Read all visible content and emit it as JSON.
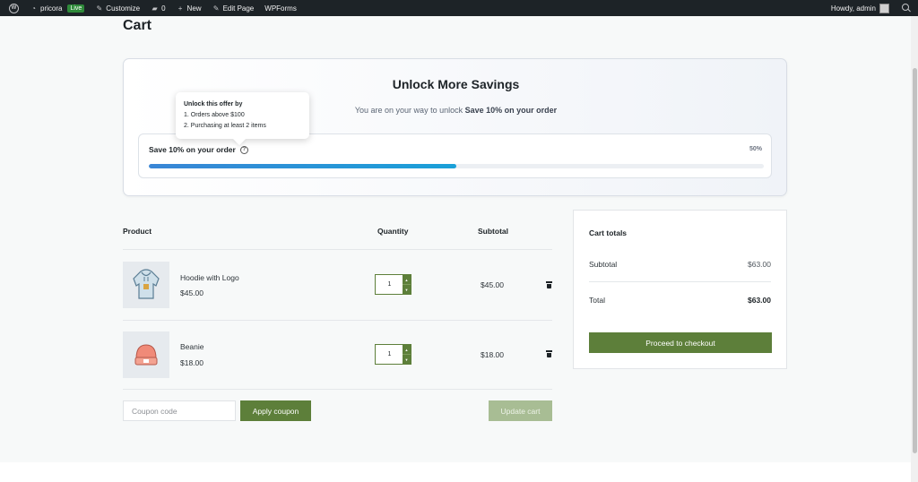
{
  "adminbar": {
    "site_name": "pricora",
    "live_badge": "Live",
    "customize": "Customize",
    "comments_count": "0",
    "new": "New",
    "edit_page": "Edit Page",
    "wpforms": "WPForms",
    "howdy": "Howdy, admin"
  },
  "page": {
    "title": "Cart"
  },
  "savings": {
    "title": "Unlock More Savings",
    "subtitle_prefix": "You are on your way to unlock",
    "subtitle_offer": "Save 10% on your order",
    "offer_label": "Save 10% on your order",
    "progress_label": "50%",
    "progress_fraction": 0.5,
    "progress_color": "#1aa0d8"
  },
  "tooltip": {
    "title": "Unlock this offer by",
    "line1": "1. Orders above $100",
    "line2": "2. Purchasing at least 2 items"
  },
  "table": {
    "headers": {
      "product": "Product",
      "quantity": "Quantity",
      "subtotal": "Subtotal"
    },
    "rows": [
      {
        "name": "Hoodie with Logo",
        "price": "$45.00",
        "qty": "1",
        "subtotal": "$45.00",
        "image": "hoodie-image"
      },
      {
        "name": "Beanie",
        "price": "$18.00",
        "qty": "1",
        "subtotal": "$18.00",
        "image": "beanie-image"
      }
    ]
  },
  "coupon": {
    "placeholder": "Coupon code",
    "apply_label": "Apply coupon",
    "update_label": "Update cart"
  },
  "totals": {
    "title": "Cart totals",
    "subtotal_label": "Subtotal",
    "subtotal_value": "$63.00",
    "total_label": "Total",
    "total_value": "$63.00",
    "checkout_label": "Proceed to checkout"
  },
  "colors": {
    "accent": "#5d7f3a",
    "adminbar": "#1d2327"
  }
}
